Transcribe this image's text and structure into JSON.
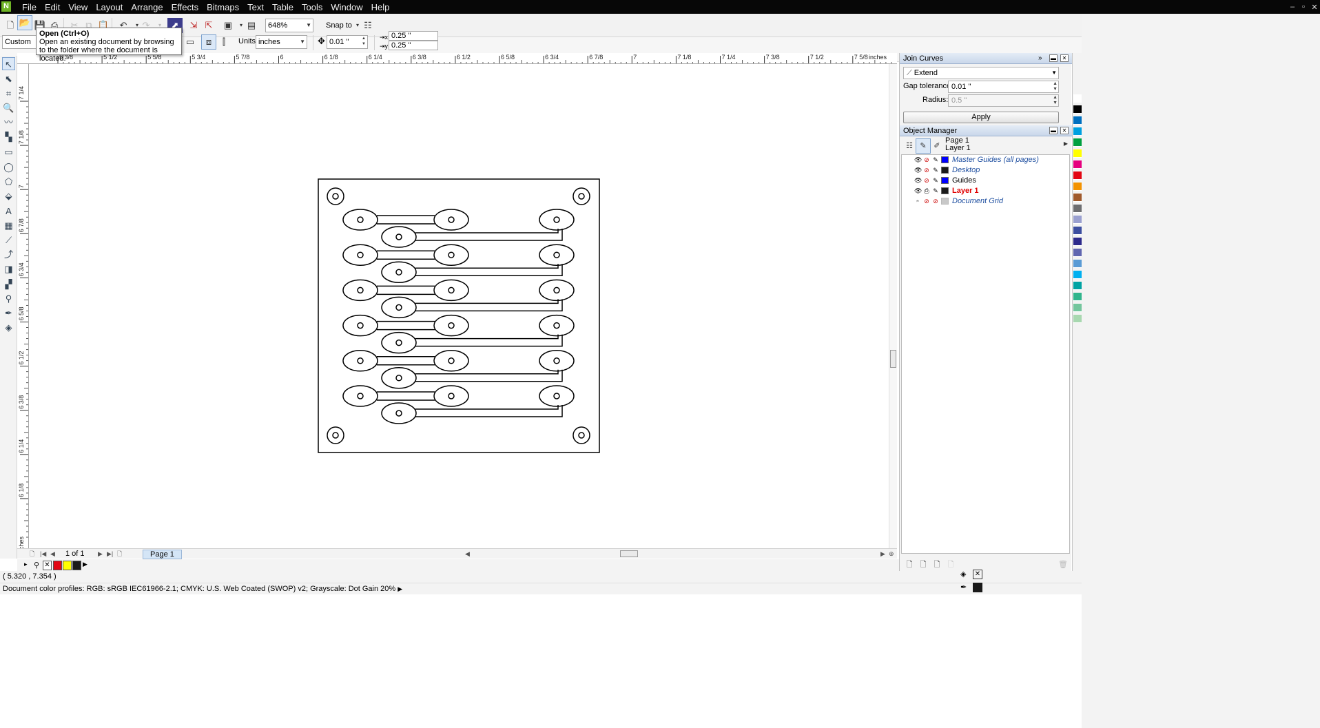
{
  "menu": [
    "File",
    "Edit",
    "View",
    "Layout",
    "Arrange",
    "Effects",
    "Bitmaps",
    "Text",
    "Table",
    "Tools",
    "Window",
    "Help"
  ],
  "toolbar": {
    "zoom": "648%",
    "snap_to": "Snap to",
    "preset": "Custom",
    "units_label": "Units:",
    "units_value": "inches",
    "nudge": "0.01 \"",
    "dup_x": "0.25 \"",
    "dup_y": "0.25 \""
  },
  "tooltip": {
    "title": "Open (Ctrl+O)",
    "text": "Open an existing document by browsing to the folder where the document is located."
  },
  "ruler": {
    "h_labels": [
      "5 3/8",
      "5 1/2",
      "5 5/8",
      "5 3/4",
      "5 7/8",
      "6",
      "6 1/8",
      "6 1/4",
      "6 3/8",
      "6 1/2",
      "6 5/8",
      "6 3/4",
      "6 7/8",
      "7",
      "7 1/8",
      "7 1/4",
      "7 3/8",
      "7 1/2",
      "7 5/8"
    ],
    "h_unit": "inches",
    "v_labels": [
      "7 1/4",
      "7 1/8",
      "7",
      "6 7/8",
      "6 3/4",
      "6 5/8",
      "6 1/2",
      "6 3/8",
      "6 1/4",
      "6 1/8"
    ],
    "v_unit": "inches"
  },
  "navigator": {
    "page_count": "1 of 1",
    "page_tab": "Page 1"
  },
  "status": {
    "coordinates": "( 5.320 , 7.354 )",
    "color_profiles": "Document color profiles: RGB: sRGB IEC61966-2.1; CMYK: U.S. Web Coated (SWOP) v2; Grayscale: Dot Gain 20%"
  },
  "join_curves": {
    "title": "Join Curves",
    "mode": "Extend",
    "gap_label": "Gap tolerance:",
    "gap_value": "0.01 \"",
    "radius_label": "Radius:",
    "radius_value": "0.5 \"",
    "apply": "Apply"
  },
  "object_manager": {
    "title": "Object Manager",
    "page": "Page 1",
    "layer": "Layer 1",
    "layers": [
      {
        "name": "Master Guides (all pages)",
        "color": "#0000ff"
      },
      {
        "name": "Desktop",
        "color": "#1a1a1a"
      },
      {
        "name": "Guides",
        "color": "#0000ff"
      },
      {
        "name": "Layer 1",
        "color": "#1a1a1a"
      },
      {
        "name": "Document Grid",
        "color": "#c8c8c8"
      }
    ]
  },
  "colors": {
    "accent": "#dbe8f7",
    "active_layer": "#e00000",
    "master_layer": "#1f4fa0"
  },
  "palette": [
    "#ffffff",
    "#000000",
    "#0070c0",
    "#00a0e0",
    "#00a040",
    "#ffff00",
    "#e6007e",
    "#e30613",
    "#f39200",
    "#a05a2c",
    "#6d6e71",
    "#9aa0d0",
    "#3c4ea0",
    "#2d2a8c",
    "#6066b0",
    "#5a9bd5",
    "#00b0f0",
    "#00a3a3",
    "#30b58c",
    "#74c69d",
    "#a8d8b0"
  ],
  "doc_palette": [
    "#e30613",
    "#ffff00",
    "#1a1a1a"
  ]
}
